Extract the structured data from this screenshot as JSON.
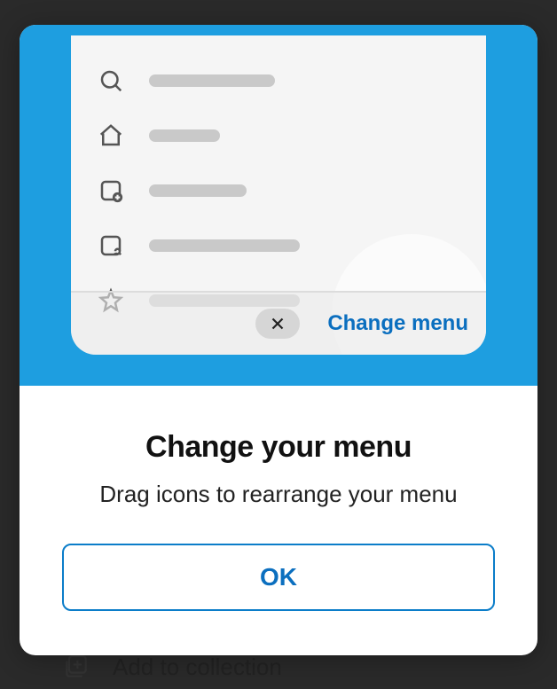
{
  "background": {
    "add_to_collection_label": "Add to collection"
  },
  "preview": {
    "footer": {
      "change_menu_label": "Change menu"
    }
  },
  "modal": {
    "title": "Change your menu",
    "subtitle": "Drag icons to rearrange your menu",
    "ok_label": "OK"
  }
}
